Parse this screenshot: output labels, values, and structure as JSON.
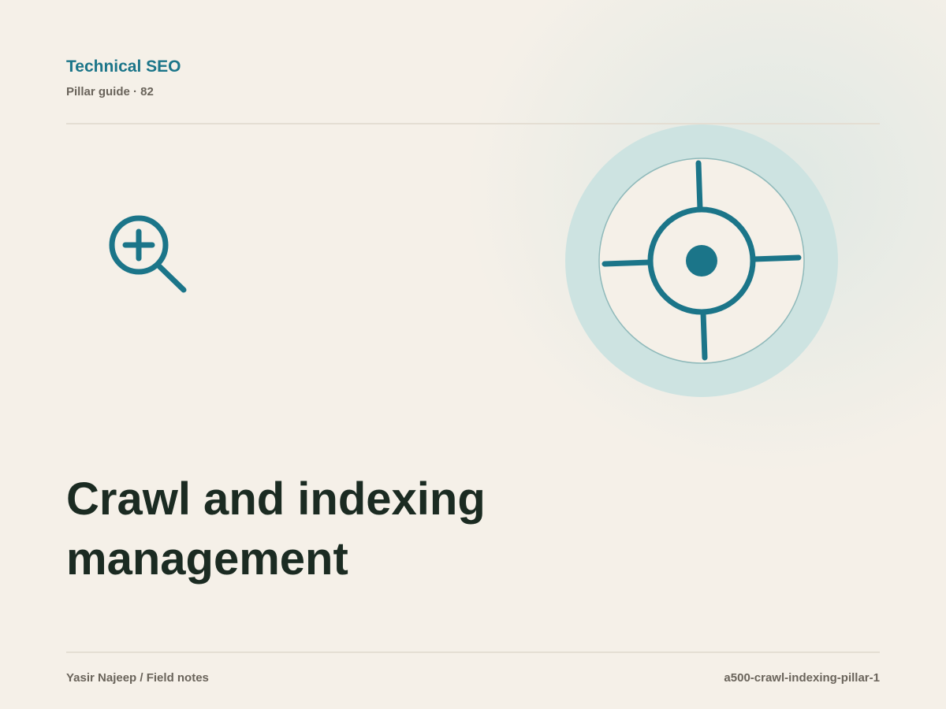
{
  "header": {
    "category": "Technical SEO",
    "subtitle": "Pillar guide · 82"
  },
  "headline": {
    "line1": "Crawl and indexing",
    "line2": "management"
  },
  "footer": {
    "author": "Yasir Najeep / Field notes",
    "slug": "a500-crawl-indexing-pillar-1"
  },
  "icons": {
    "zoom": "zoom-in-icon",
    "target": "crosshair-target-icon"
  },
  "colors": {
    "accent": "#1b7589",
    "headline": "#1b2b22",
    "muted": "#6a645b",
    "background": "#f5f0e8",
    "halo": "#cde3e1"
  }
}
